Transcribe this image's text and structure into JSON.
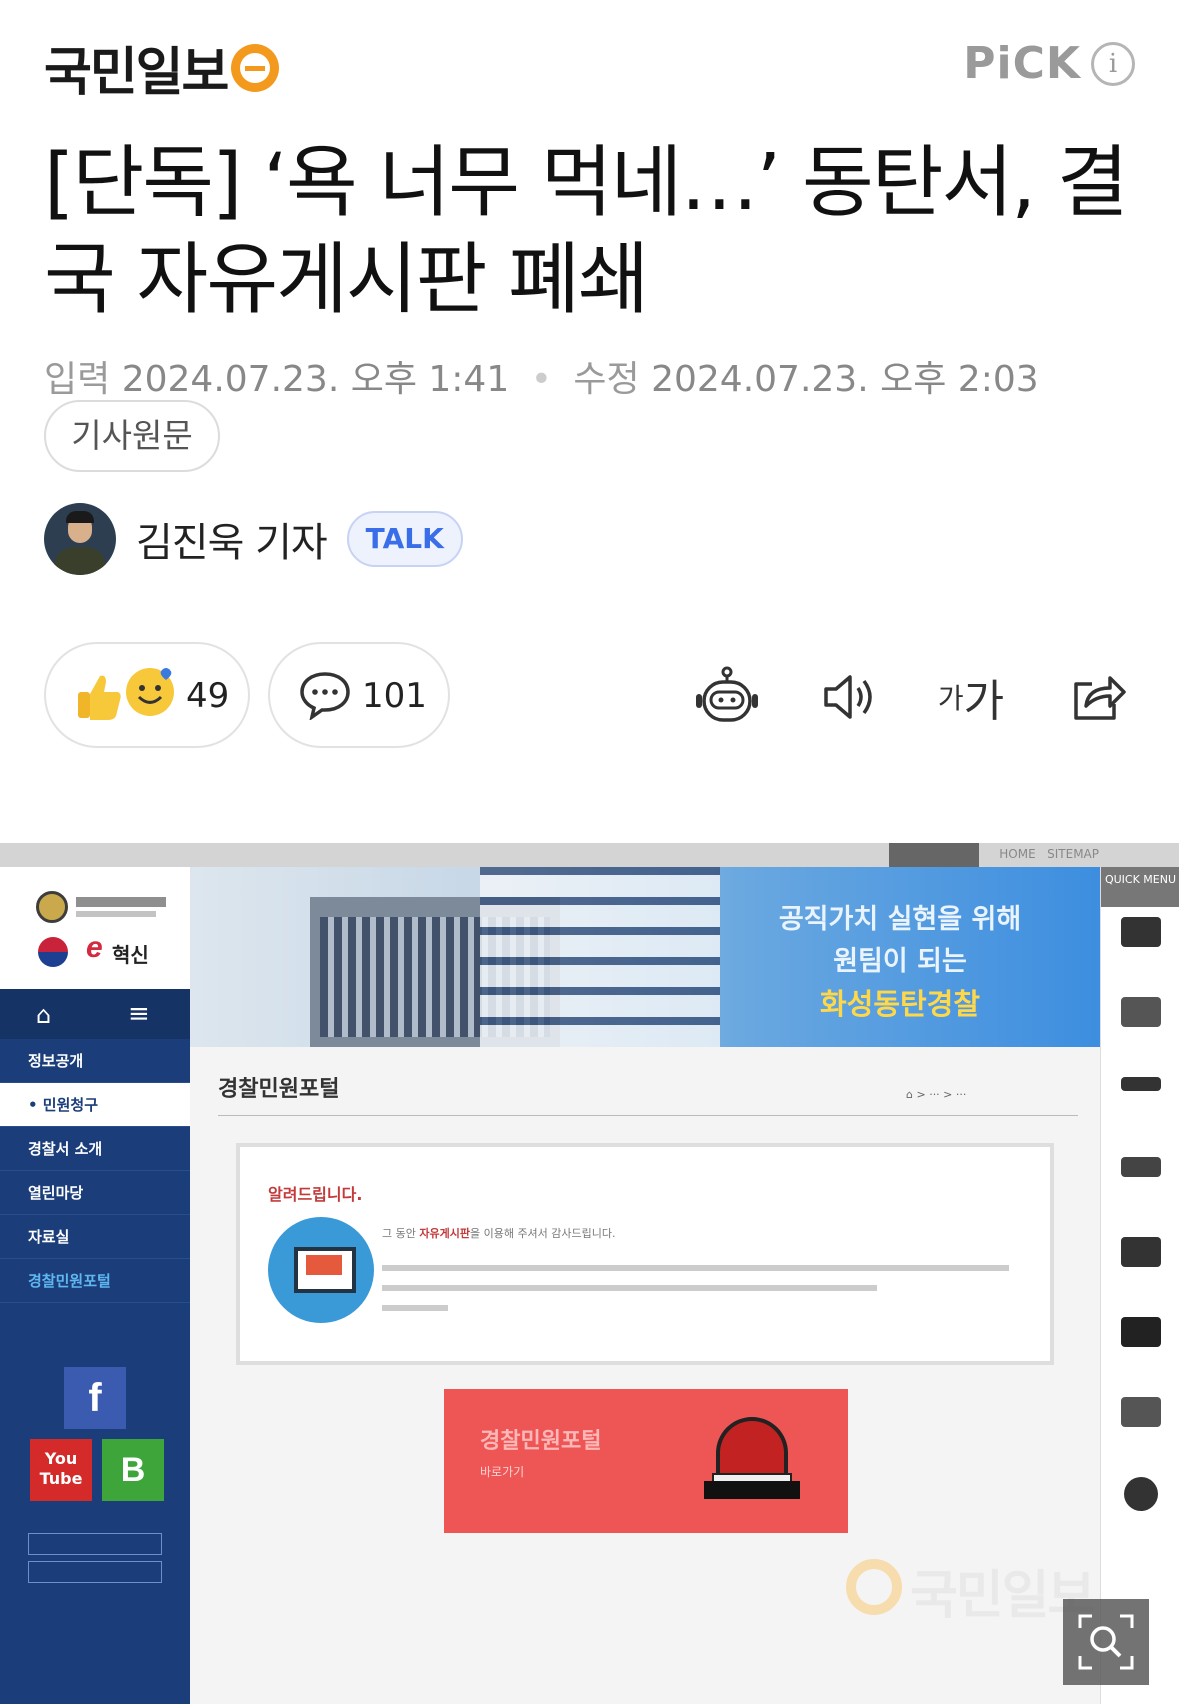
{
  "header": {
    "logo_text": "국민일보",
    "pick_label": "PiCK",
    "info_icon": "i"
  },
  "article": {
    "headline": "[단독] ‘욕 너무 먹네…’ 동탄서, 결국 자유게시판 폐쇄",
    "input_label": "입력",
    "input_time": "2024.07.23. 오후 1:41",
    "edit_label": "수정",
    "edit_time": "2024.07.23. 오후 2:03",
    "original_button": "기사원문",
    "reporter_name": "김진욱 기자",
    "talk_button": "TALK"
  },
  "actions": {
    "reaction_count": "49",
    "comment_count": "101",
    "icons": [
      "summary-bot-icon",
      "speaker-icon",
      "font-size-icon",
      "share-icon"
    ],
    "font_small": "가",
    "font_large": "가"
  },
  "image": {
    "site_e": "e",
    "site_e_text": "혁신",
    "banner_line1": "공직가치 실현을 위해",
    "banner_line2": "원팀이 되는",
    "banner_line3": "화성동탄경찰",
    "menu": [
      "정보공개",
      "• 민원청구",
      "경찰서 소개",
      "열린마당",
      "자료실",
      "경찰민원포털"
    ],
    "content_title": "경찰민원포털",
    "notice_title": "알려드립니다.",
    "notice_line_prefix": "그 동안 ",
    "notice_line_highlight": "자유게시판",
    "notice_line_suffix": "을 이용해 주셔서 감사드립니다.",
    "portal_title": "경찰민원포털",
    "portal_sub": "바로가기",
    "sns_f": "f",
    "sns_yt": "You Tube",
    "sns_b": "B",
    "watermark": "국민일보",
    "quick_menu": "QUICK MENU"
  },
  "colors": {
    "brand_orange": "#f39a1e",
    "talk_blue": "#3a6ee8",
    "site_navy": "#1b3d7a",
    "portal_red": "#ee5555"
  }
}
